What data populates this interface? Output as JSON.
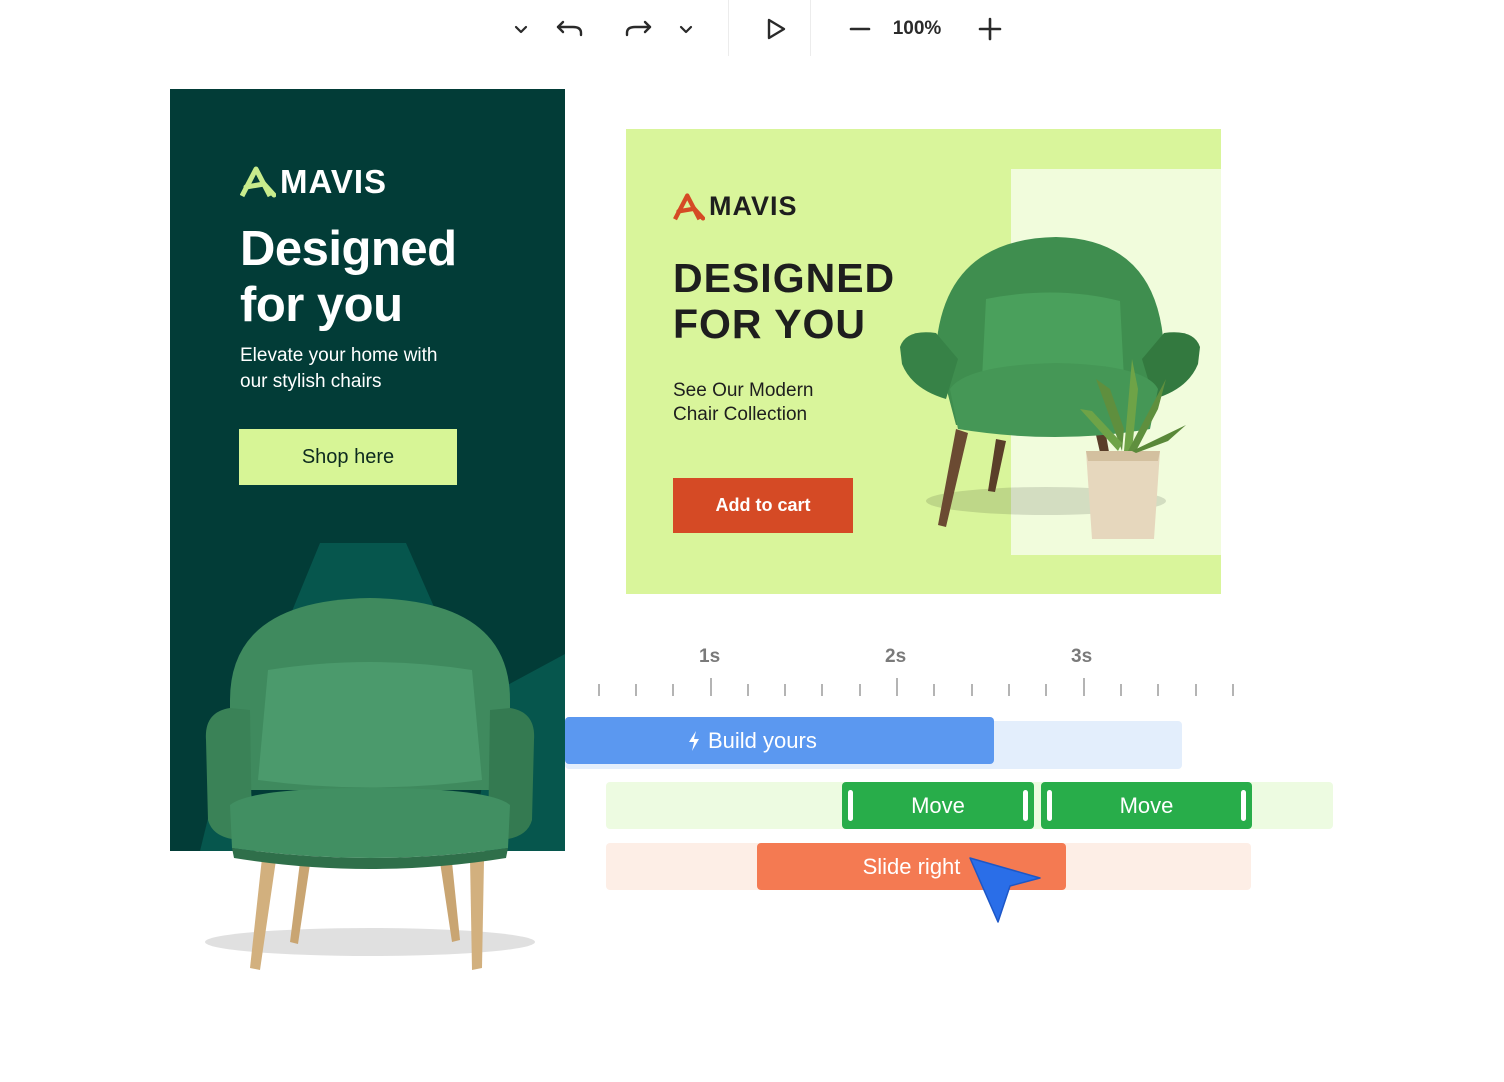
{
  "toolbar": {
    "zoom_label": "100%"
  },
  "tall_banner": {
    "brand": "MAVIS",
    "headline_line1": "Designed",
    "headline_line2": "for you",
    "subtext_line1": "Elevate your home with",
    "subtext_line2": "our stylish chairs",
    "cta": "Shop here",
    "colors": {
      "background": "#023c37",
      "accent": "#d7f596"
    }
  },
  "wide_banner": {
    "brand": "MAVIS",
    "headline_line1": "DESIGNED",
    "headline_line2": "FOR YOU",
    "subtext_line1": "See Our Modern",
    "subtext_line2": "Chair Collection",
    "cta": "Add to cart",
    "colors": {
      "background": "#d9f59b",
      "cta": "#d54a25"
    }
  },
  "timeline": {
    "ticks": [
      "1s",
      "2s",
      "3s"
    ],
    "tracks": {
      "build": {
        "label": "Build yours",
        "color": "#5b98f0"
      },
      "move_1": {
        "label": "Move",
        "color": "#28ad4a"
      },
      "move_2": {
        "label": "Move",
        "color": "#28ad4a"
      },
      "slide": {
        "label": "Slide right",
        "color": "#f47a52"
      }
    }
  }
}
